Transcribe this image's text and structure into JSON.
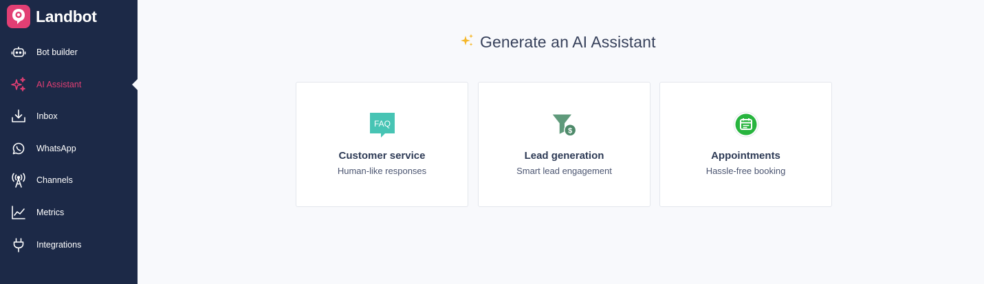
{
  "app": {
    "brand": "Landbot",
    "brand_color": "#e23f74",
    "sidebar_bg": "#1c2947"
  },
  "sidebar": {
    "items": [
      {
        "label": "Bot builder",
        "icon": "robot-icon",
        "active": false
      },
      {
        "label": "AI Assistant",
        "icon": "sparkles-icon",
        "active": true
      },
      {
        "label": "Inbox",
        "icon": "inbox-download-icon",
        "active": false
      },
      {
        "label": "WhatsApp",
        "icon": "whatsapp-icon",
        "active": false
      },
      {
        "label": "Channels",
        "icon": "antenna-icon",
        "active": false
      },
      {
        "label": "Metrics",
        "icon": "line-chart-icon",
        "active": false
      },
      {
        "label": "Integrations",
        "icon": "plug-icon",
        "active": false
      }
    ]
  },
  "main": {
    "headline": {
      "icon": "sparkles-emoji-icon",
      "title": "Generate an AI Assistant"
    },
    "cards": [
      {
        "icon": "faq-icon",
        "icon_text": "FAQ",
        "title": "Customer service",
        "subtitle": "Human-like responses",
        "icon_color": "#47c4b4"
      },
      {
        "icon": "funnel-dollar-icon",
        "title": "Lead generation",
        "subtitle": "Smart lead engagement",
        "icon_color": "#5f9a7b"
      },
      {
        "icon": "calendar-chat-icon",
        "title": "Appointments",
        "subtitle": "Hassle-free booking",
        "icon_color": "#27b43e"
      }
    ]
  }
}
